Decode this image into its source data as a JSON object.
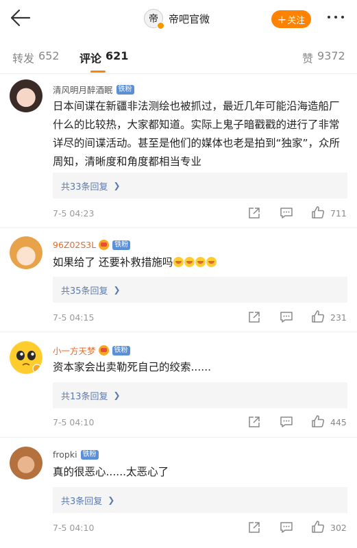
{
  "header": {
    "brand_logo_char": "帝",
    "brand_name": "帝吧官微",
    "follow_label": "关注",
    "follow_plus": "+"
  },
  "tabs": [
    {
      "label": "转发",
      "count": "652"
    },
    {
      "label": "评论",
      "count": "621"
    },
    {
      "label": "赞",
      "count": "9372"
    }
  ],
  "comments": [
    {
      "username": "清风明月醉酒眠",
      "username_color": "#555555",
      "badge": "铁粉",
      "has_crown": false,
      "text": "日本间谍在新疆非法测绘也被抓过，最近几年可能沿海造船厂什么的比较热，大家都知道。实际上鬼子暗戳戳的进行了非常详尽的间谍活动。甚至是他们的媒体也老是拍到“独家”，众所周知，清晰度和角度都相当专业",
      "replies": "共33条回复",
      "time": "7-5 04:23",
      "likes": "711"
    },
    {
      "username": "96Z02S3L",
      "username_color": "#e86a28",
      "badge": "铁粉",
      "has_crown": true,
      "text": "如果给了 还要补救措施吗",
      "emoji_count": 4,
      "replies": "共35条回复",
      "time": "7-5 04:15",
      "likes": "231"
    },
    {
      "username": "小一方天梦",
      "username_color": "#e86a28",
      "badge": "铁粉",
      "has_crown": true,
      "text": "资本家会出卖勒死自己的绞索......",
      "replies": "共13条回复",
      "time": "7-5 04:10",
      "likes": "445"
    },
    {
      "username": "fropki",
      "username_color": "#555555",
      "badge": "铁粉",
      "has_crown": false,
      "text": "真的很恶心......太恶心了",
      "replies": "共3条回复",
      "time": "7-5 04:10",
      "likes": "302"
    }
  ],
  "icons": {
    "back": "back-arrow-icon",
    "share": "share-icon",
    "comment": "comment-icon",
    "like": "thumbs-up-icon",
    "more": "more-dots-icon"
  },
  "colors": {
    "accent": "#ff8200",
    "fan_badge": "#5b8fd6",
    "reply_link": "#5b7bb0"
  }
}
